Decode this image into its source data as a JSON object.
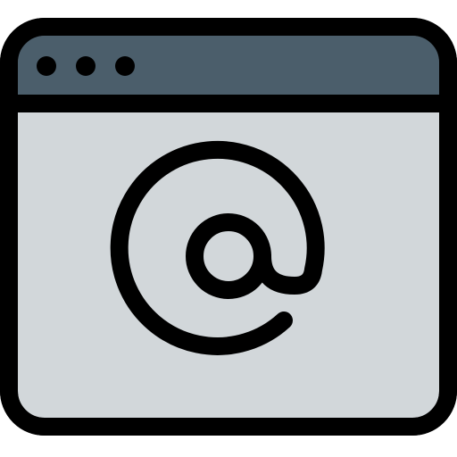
{
  "icon": {
    "name": "browser-window-email-icon",
    "symbol": "@",
    "colors": {
      "outline": "#000000",
      "title_bar": "#4b5e6b",
      "content": "#d2d7da",
      "background": "#ffffff"
    }
  }
}
